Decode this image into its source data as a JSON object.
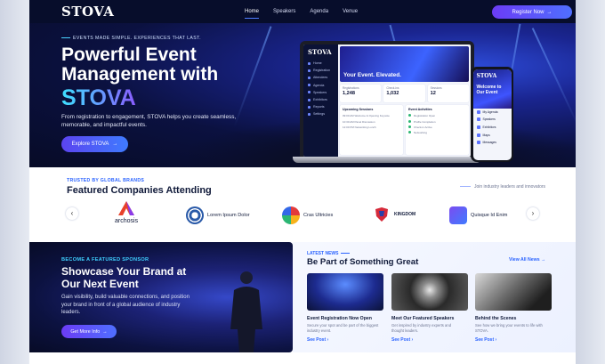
{
  "nav": {
    "logo": "STOVA",
    "links": [
      "Home",
      "Speakers",
      "Agenda",
      "Venue"
    ],
    "cta": "Register Now"
  },
  "hero": {
    "kicker": "EVENTS MADE SIMPLE. EXPERIENCES THAT LAST.",
    "title_line1": "Powerful Event",
    "title_line2": "Management with",
    "title_brand": "STOVA",
    "subtitle": "From registration to engagement, STOVA helps you create seamless, memorable, and impactful events.",
    "button": "Explore STOVA",
    "arrow": "→"
  },
  "laptop": {
    "logo": "STOVA",
    "menu": [
      "Home",
      "Registration",
      "Attendees",
      "Agenda",
      "Speakers",
      "Exhibitors",
      "Reports",
      "Settings"
    ],
    "banner": "Your Event. Elevated.",
    "stats": [
      {
        "label": "Registrations",
        "value": "1,248"
      },
      {
        "label": "Check-ins",
        "value": "1,032"
      },
      {
        "label": "Sessions",
        "value": "12"
      }
    ],
    "upcoming_title": "Upcoming Sessions",
    "upcoming": [
      "09:00 AM  Welcome & Opening Keynote",
      "10:30 AM  Panel Discussion",
      "12:00 PM  Networking Lunch"
    ],
    "activities_title": "Event Activities",
    "activities": [
      "Registration Open",
      "Profile Completion",
      "Check-in Active",
      "Networking"
    ]
  },
  "phone": {
    "logo": "STOVA",
    "welcome": "Welcome to Our Event",
    "menu": [
      "My Agenda",
      "Speakers",
      "Exhibitors",
      "Maps",
      "Messages"
    ]
  },
  "trusted": {
    "kicker": "TRUSTED BY GLOBAL BRANDS",
    "title": "Featured Companies Attending",
    "join": "Join industry leaders and innovators",
    "prev": "‹",
    "next": "›",
    "brands": [
      "archosis",
      "Lorem Ipsum Dolor",
      "Cras Ultricies",
      "KINGDOM",
      "Quisque Id Enim"
    ]
  },
  "sponsor": {
    "kicker": "BECOME A FEATURED SPONSOR",
    "title": "Showcase Your Brand at Our Next Event",
    "body": "Gain visibility, build valuable connections, and position your brand in front of a global audience of industry leaders.",
    "button": "Get More Info",
    "arrow": "→"
  },
  "news": {
    "kicker": "LATEST NEWS",
    "title": "Be Part of Something Great",
    "all": "View All News →",
    "cards": [
      {
        "title": "Event Registration Now Open",
        "body": "Secure your spot and be part of the biggest industry event.",
        "link": "See Post ›"
      },
      {
        "title": "Meet Our Featured Speakers",
        "body": "Get inspired by industry experts and thought leaders.",
        "link": "See Post ›"
      },
      {
        "title": "Behind the Scenes",
        "body": "See how we bring your events to life with STOVA.",
        "link": "See Post ›"
      }
    ]
  },
  "colors": {
    "navy": "#070d2b",
    "accent": "#4f6fff",
    "violet": "#6b3cf5",
    "cyan": "#3ee0ff"
  }
}
